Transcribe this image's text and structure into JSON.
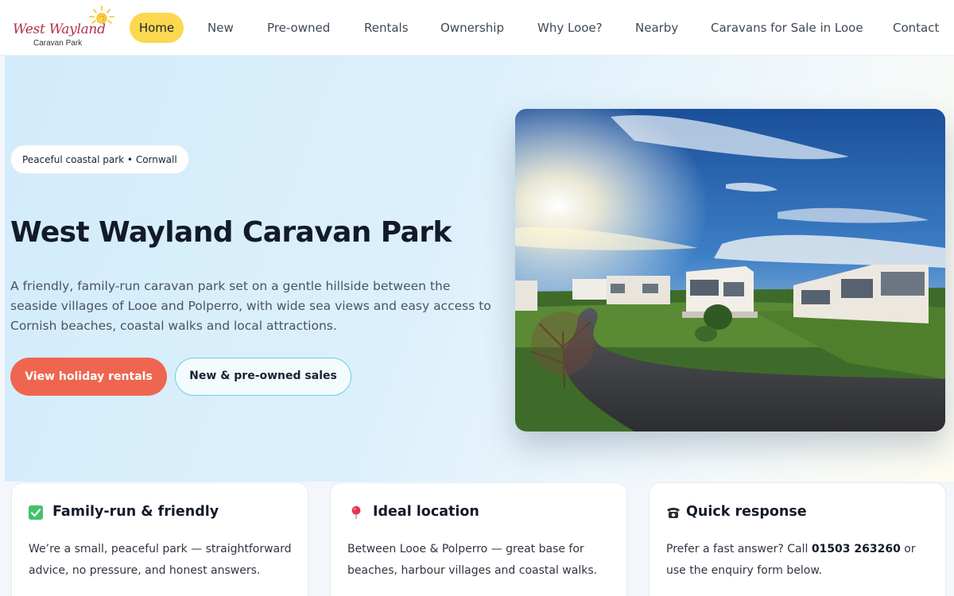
{
  "logo": {
    "script_text": "West Wayland",
    "subtitle": "Caravan Park"
  },
  "nav": {
    "items": [
      {
        "label": "Home",
        "active": true
      },
      {
        "label": "New"
      },
      {
        "label": "Pre-owned"
      },
      {
        "label": "Rentals"
      },
      {
        "label": "Ownership"
      },
      {
        "label": "Why Looe?"
      },
      {
        "label": "Nearby"
      },
      {
        "label": "Caravans for Sale in Looe"
      },
      {
        "label": "Contact"
      }
    ]
  },
  "hero": {
    "badge": "Peaceful coastal park • Cornwall",
    "title": "West Wayland Caravan Park",
    "description": "A friendly, family-run caravan park set on a gentle hillside between the seaside villages of Looe and Polperro, with wide sea views and easy access to Cornish beaches, coastal walks and local attractions.",
    "primary_button": "View holiday rentals",
    "secondary_button": "New & pre-owned sales"
  },
  "cards": [
    {
      "icon": "check-icon",
      "title": "Family-run & friendly",
      "body": "We’re a small, peaceful park — straightforward advice, no pressure, and honest answers."
    },
    {
      "icon": "pin-icon",
      "title": "Ideal location",
      "body": "Between Looe & Polperro — great base for beaches, harbour villages and coastal walks."
    },
    {
      "icon": "phone-icon",
      "title": "Quick response",
      "body_prefix": "Prefer a fast answer? Call ",
      "phone": "01503 263260",
      "body_suffix": " or use the enquiry form below."
    }
  ],
  "colors": {
    "nav_active": "#fbd84f",
    "primary_button": "#ee6650",
    "secondary_border": "#67cfe6",
    "logo_script": "#b2324b"
  }
}
